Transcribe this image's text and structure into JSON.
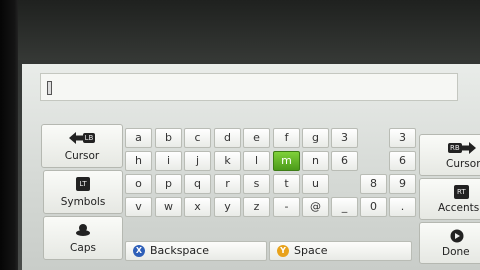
{
  "text_field": {
    "value": ""
  },
  "left_keys": [
    {
      "label": "Cursor",
      "icon": "arrow-left-icon",
      "badge": "LB"
    },
    {
      "label": "Symbols",
      "icon": "lt-trigger-icon",
      "badge": "LT"
    },
    {
      "label": "Caps",
      "icon": "thumbstick-icon"
    }
  ],
  "right_keys": [
    {
      "label": "Cursor",
      "icon": "arrow-right-icon",
      "badge": "RB"
    },
    {
      "label": "Accents",
      "icon": "rt-trigger-icon",
      "badge": "RT"
    },
    {
      "label": "Done",
      "icon": "start-button-icon"
    }
  ],
  "keyboard": {
    "rows": [
      [
        "a",
        "b",
        "c",
        "d",
        "e",
        "f",
        "g",
        "3",
        "3"
      ],
      [
        "h",
        "i",
        "j",
        "k",
        "l",
        "m",
        "n",
        "6",
        "6"
      ],
      [
        "o",
        "p",
        "q",
        "r",
        "s",
        "t",
        "u",
        "8",
        "9"
      ],
      [
        "v",
        "w",
        "x",
        "y",
        "z",
        "-",
        "@",
        "_",
        "0",
        "."
      ]
    ],
    "selected_key": "m"
  },
  "bottom_keys": {
    "backspace": {
      "label": "Backspace",
      "button": "X",
      "color": "#2e5fb8"
    },
    "space": {
      "label": "Space",
      "button": "Y",
      "color": "#e8a21b"
    }
  }
}
